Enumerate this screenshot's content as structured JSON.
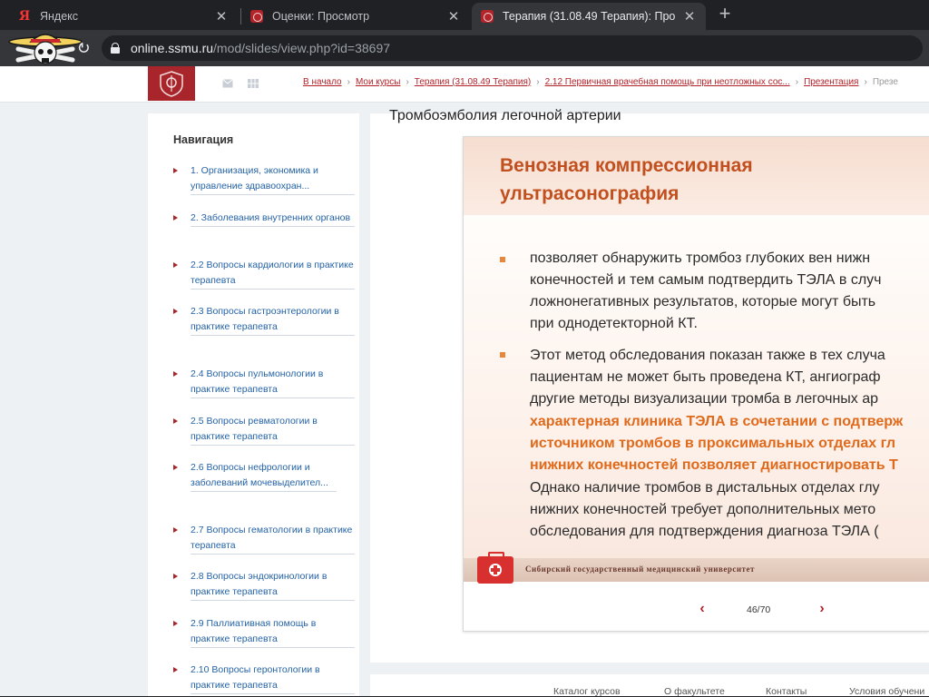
{
  "browser": {
    "tabs": [
      {
        "title": "Яндекс",
        "active": false
      },
      {
        "title": "Оценки: Просмотр",
        "active": false
      },
      {
        "title": "Терапия (31.08.49 Терапия): Про",
        "active": true
      }
    ],
    "url_host": "online.ssmu.ru",
    "url_path": "/mod/slides/view.php?id=38697"
  },
  "breadcrumb": {
    "items": [
      "В начало",
      "Мои курсы",
      "Терапия (31.08.49 Терапия)",
      "2.12 Первичная врачебная помощь при неотложных сос...",
      "Презентация"
    ],
    "last": "Презе"
  },
  "sidebar": {
    "title": "Навигация",
    "items": [
      {
        "label": "1. Организация, экономика и управление здравоохран..."
      },
      {
        "label": "2. Заболевания внутренних органов"
      },
      {
        "label": "2.2 Вопросы кардиологии в практике терапевта"
      },
      {
        "label": "2.3 Вопросы гастроэнтерологии в практике терапевта"
      },
      {
        "label": "2.4 Вопросы пульмонологии в практике терапевта"
      },
      {
        "label": "2.5 Вопросы ревматологии в практике терапевта"
      },
      {
        "label": "2.6 Вопросы нефрологии и заболеваний мочевыделител..."
      },
      {
        "label": "2.7 Вопросы гематологии в практике терапевта"
      },
      {
        "label": "2.8 Вопросы эндокринологии в практике терапевта"
      },
      {
        "label": "2.9 Паллиативная помощь в практике терапевта"
      },
      {
        "label": "2.10 Вопросы геронтологии в практике терапевта"
      }
    ]
  },
  "content": {
    "title": "Тромбоэмболия легочной артерии"
  },
  "slide": {
    "title": "Венозная компрессионная ультрасонография",
    "lines": [
      "позволяет обнаружить тромбоз глубоких вен нижн",
      "конечностей и тем самым подтвердить ТЭЛА в случ",
      "ложнонегативных результатов, которые могут быть",
      "при однодетекторной  КТ.",
      "Этот метод обследования показан также в тех случа",
      "пациентам не может быть проведена КТ, ангиограф",
      "другие методы визуализации тромба в легочных ар",
      "характерная клиника ТЭЛА в сочетании с подтверж",
      "источником тромбов в проксимальных отделах гл",
      "нижних конечностей позволяет диагностировать Т",
      "Однако наличие тромбов в дистальных отделах глу",
      "нижних конечностей требует дополнительных мето",
      "обследования для подтверждения диагноза ТЭЛА ("
    ],
    "university": "Сибирский государственный медицинский университет",
    "page_counter": "46/70",
    "prev_glyph": "‹",
    "next_glyph": "›"
  },
  "footer": {
    "links": [
      "Каталог курсов",
      "О факультете",
      "Контакты",
      "Условия обучени"
    ]
  },
  "colors": {
    "brand_red": "#a8262b",
    "slide_orange": "#c2501f",
    "link_blue": "#2563a6"
  }
}
